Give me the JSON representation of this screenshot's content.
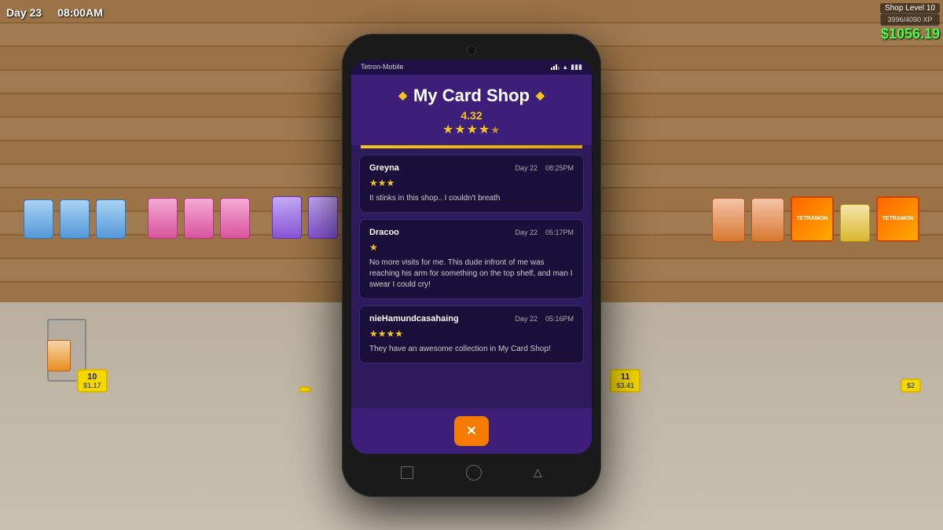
{
  "hud": {
    "day": "Day 23",
    "time": "08:00AM",
    "shop_level": "Shop Level 10",
    "xp": "3996/4090 XP",
    "money": "$1056.19"
  },
  "phone": {
    "carrier": "Tetron-Mobile",
    "app": {
      "title": "My Card Shop",
      "rating_number": "4.32",
      "stars": "★★★★½",
      "separator_color": "#f5c518"
    },
    "reviews": [
      {
        "name": "Greyna",
        "day": "Day 22",
        "time": "08:25PM",
        "stars": "★★★",
        "text": "It stinks in this shop.. I couldn't breath"
      },
      {
        "name": "Dracoo",
        "day": "Day 22",
        "time": "05:17PM",
        "stars": "★",
        "text": "No more visits for me. This dude infront of me was reaching his arm for something on the top shelf, and man I swear I could cry!"
      },
      {
        "name": "nieHamundcasahaing",
        "day": "Day 22",
        "time": "05:16PM",
        "stars": "★★★★",
        "text": "They have an awesome collection in My Card Shop!"
      }
    ],
    "close_button_label": "✕",
    "nav_buttons": [
      "□",
      "○",
      "△"
    ]
  },
  "price_tags": [
    {
      "id": "tag1",
      "count": "10",
      "price": "$1.17"
    },
    {
      "id": "tag2",
      "count": "",
      "price": ""
    },
    {
      "id": "tag3",
      "count": "11",
      "price": "$3.41"
    },
    {
      "id": "tag4",
      "count": "",
      "price": "$2"
    }
  ]
}
